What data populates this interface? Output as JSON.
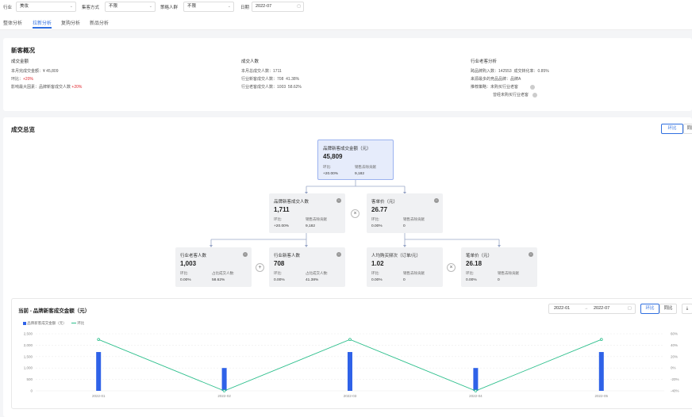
{
  "filters": {
    "industry_label": "行业",
    "industry_value": "美妆",
    "collection_label": "集客方式",
    "collection_value": "不限",
    "strategist_label": "策略人群",
    "strategist_value": "不限",
    "date_label": "日期",
    "date_value": "2022-07"
  },
  "tabs": [
    "整体分析",
    "拉新分析",
    "复购分析",
    "新品分析"
  ],
  "overview": {
    "title": "新客概况",
    "deal_amount": {
      "heading": "成交金额",
      "line1_label": "本月完成交金额：",
      "line1_value": "¥ 45,809",
      "line2_label": "环比：",
      "line2_value": "+20%",
      "line3_label": "影响最大因素：",
      "line3_text": "品牌新客成交人数",
      "line3_value": "+20%"
    },
    "deal_people": {
      "heading": "成交人数",
      "line1_label": "本月总成交人数：",
      "line1_value": "1711",
      "line2_label": "行业新客成交人数：",
      "line2_value": "708",
      "line2_pct": "41.38%",
      "line3_label": "行业老客成交人数：",
      "line3_value": "1003",
      "line3_pct": "58.62%"
    },
    "industry": {
      "heading": "行业老客分析",
      "line1_label": "跨品牌购入数：",
      "line1_value": "142553",
      "line1b_label": "成交转化率：",
      "line1b_value": "0.85%",
      "line2_label": "来源最多的竞品品牌：",
      "line2_value": "品牌A",
      "line3_label": "推荐策略：",
      "line3_value": "未购买行业老客",
      "line4_value": "曾经未购买行业老客"
    }
  },
  "summary": {
    "title": "成交总览",
    "btn_mom": "环比",
    "btn_yoy": "同比",
    "root": {
      "title": "品牌新客成交金额（元）",
      "value": "45,809",
      "l1": "环比:",
      "l2": "销售去除贡献",
      "v1": "+20.00%",
      "v2": "9,182"
    },
    "n_people": {
      "title": "品牌新客成交人数",
      "value": "1,711",
      "l1": "环比:",
      "l2": "销售去除贡献",
      "v1": "+20.00%",
      "v2": "9,182"
    },
    "n_unit": {
      "title": "客单价（元）",
      "value": "26.77",
      "l1": "环比:",
      "l2": "销售去除贡献",
      "v1": "0.00%",
      "v2": "0"
    },
    "n_old": {
      "title": "行业老客人数",
      "value": "1,003",
      "l1": "环比:",
      "l2": "占比成交人数:",
      "v1": "0.00%",
      "v2": "58.62%"
    },
    "n_new": {
      "title": "行业新客人数",
      "value": "708",
      "l1": "环比:",
      "l2": "占比成交人数:",
      "v1": "0.00%",
      "v2": "41.38%"
    },
    "n_freq": {
      "title": "人均购买频次（订单/元）",
      "value": "1.02",
      "l1": "环比:",
      "l2": "销售去除贡献",
      "v1": "0.00%",
      "v2": "0"
    },
    "n_price": {
      "title": "笔单价（元）",
      "value": "26.18",
      "l1": "环比:",
      "l2": "销售去除贡献",
      "v1": "0.00%",
      "v2": "0"
    },
    "op_times": "×",
    "op_plus": "+"
  },
  "trend": {
    "title": "当前 - 品牌新客成交金额（元）",
    "date_start": "2022-01",
    "date_arrow": "→",
    "date_end": "2022-07",
    "btn_mom": "环比",
    "btn_yoy": "同比",
    "legend_bar": "品牌新客成交金额（元）",
    "legend_line": "环比"
  },
  "chart_data": {
    "type": "bar",
    "categories": [
      "2022-01",
      "2022-02",
      "2022-03",
      "2022-04",
      "2022-05"
    ],
    "series": [
      {
        "name": "品牌新客成交金额（元）",
        "type": "bar",
        "values": [
          1700,
          1000,
          1700,
          1000,
          1700
        ]
      },
      {
        "name": "环比",
        "type": "line",
        "values": [
          50,
          -40,
          50,
          -40,
          50
        ]
      }
    ],
    "y_left_ticks": [
      "2,500",
      "2,000",
      "1,500",
      "1,000",
      "500",
      "0"
    ],
    "y_right_ticks": [
      "60%",
      "40%",
      "20%",
      "0%",
      "-20%",
      "-40%"
    ],
    "ylim_left": [
      0,
      2500
    ],
    "ylim_right": [
      -40,
      60
    ],
    "colors": {
      "bar": "#2f62e8",
      "line": "#2dbf8c"
    }
  }
}
